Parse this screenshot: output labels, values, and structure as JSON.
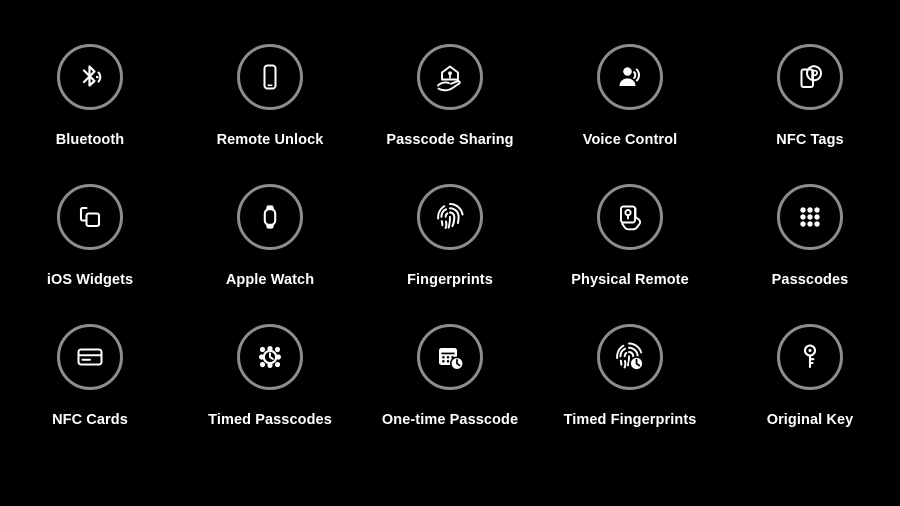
{
  "canvas": {
    "background_color": "#000000",
    "label_color": "#ffffff",
    "ring_color": "#8d8d8d",
    "columns": 5,
    "rows": 3
  },
  "grid": {
    "items": [
      {
        "label": "Bluetooth",
        "icon": "bluetooth-icon"
      },
      {
        "label": "Remote Unlock",
        "icon": "smartphone-icon"
      },
      {
        "label": "Passcode Sharing",
        "icon": "house-on-hand-icon"
      },
      {
        "label": "Voice Control",
        "icon": "person-voice-icon"
      },
      {
        "label": "NFC Tags",
        "icon": "nfc-tag-phone-icon"
      },
      {
        "label": "iOS Widgets",
        "icon": "widgets-squares-icon"
      },
      {
        "label": "Apple Watch",
        "icon": "apple-watch-icon"
      },
      {
        "label": "Fingerprints",
        "icon": "fingerprint-icon"
      },
      {
        "label": "Physical Remote",
        "icon": "remote-fob-hand-icon"
      },
      {
        "label": "Passcodes",
        "icon": "keypad-dots-icon"
      },
      {
        "label": "NFC Cards",
        "icon": "credit-card-icon"
      },
      {
        "label": "Timed Passcodes",
        "icon": "keypad-clock-icon"
      },
      {
        "label": "One-time Passcode",
        "icon": "calendar-clock-icon"
      },
      {
        "label": "Timed Fingerprints",
        "icon": "fingerprint-clock-icon"
      },
      {
        "label": "Original Key",
        "icon": "key-icon"
      }
    ]
  }
}
